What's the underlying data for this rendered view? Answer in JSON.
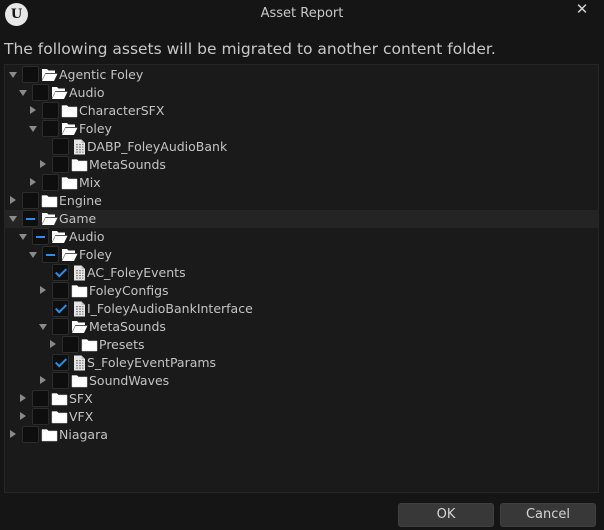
{
  "window": {
    "title": "Asset Report",
    "logo_letter": "U",
    "close_glyph": "✕"
  },
  "heading": "The following assets will be migrated to another content folder.",
  "tree": [
    {
      "label": "Agentic Foley",
      "depth": 0,
      "expander": "down",
      "check": "none",
      "icon": "folder-open-icon"
    },
    {
      "label": "Audio",
      "depth": 1,
      "expander": "down",
      "check": "none",
      "icon": "folder-open-icon"
    },
    {
      "label": "CharacterSFX",
      "depth": 2,
      "expander": "right",
      "check": "none",
      "icon": "folder-icon"
    },
    {
      "label": "Foley",
      "depth": 2,
      "expander": "down",
      "check": "none",
      "icon": "folder-open-icon"
    },
    {
      "label": "DABP_FoleyAudioBank",
      "depth": 3,
      "expander": "",
      "check": "none",
      "icon": "asset-file-icon"
    },
    {
      "label": "MetaSounds",
      "depth": 3,
      "expander": "right",
      "check": "none",
      "icon": "folder-icon"
    },
    {
      "label": "Mix",
      "depth": 2,
      "expander": "right",
      "check": "none",
      "icon": "folder-icon"
    },
    {
      "label": "Engine",
      "depth": 0,
      "expander": "right",
      "check": "none",
      "icon": "folder-icon"
    },
    {
      "label": "Game",
      "depth": 0,
      "expander": "down",
      "check": "partial",
      "icon": "folder-open-icon",
      "highlight": true
    },
    {
      "label": "Audio",
      "depth": 1,
      "expander": "down",
      "check": "partial",
      "icon": "folder-open-icon"
    },
    {
      "label": "Foley",
      "depth": 2,
      "expander": "down",
      "check": "partial",
      "icon": "folder-open-icon"
    },
    {
      "label": "AC_FoleyEvents",
      "depth": 3,
      "expander": "",
      "check": "checked",
      "icon": "asset-file-icon"
    },
    {
      "label": "FoleyConfigs",
      "depth": 3,
      "expander": "right",
      "check": "none",
      "icon": "folder-icon"
    },
    {
      "label": "I_FoleyAudioBankInterface",
      "depth": 3,
      "expander": "",
      "check": "checked",
      "icon": "asset-file-icon"
    },
    {
      "label": "MetaSounds",
      "depth": 3,
      "expander": "down",
      "check": "none",
      "icon": "folder-open-icon"
    },
    {
      "label": "Presets",
      "depth": 4,
      "expander": "right",
      "check": "none",
      "icon": "folder-icon"
    },
    {
      "label": "S_FoleyEventParams",
      "depth": 3,
      "expander": "",
      "check": "checked",
      "icon": "asset-file-icon"
    },
    {
      "label": "SoundWaves",
      "depth": 3,
      "expander": "right",
      "check": "none",
      "icon": "folder-icon"
    },
    {
      "label": "SFX",
      "depth": 1,
      "expander": "right",
      "check": "none",
      "icon": "folder-icon"
    },
    {
      "label": "VFX",
      "depth": 1,
      "expander": "right",
      "check": "none",
      "icon": "folder-icon"
    },
    {
      "label": "Niagara",
      "depth": 0,
      "expander": "right",
      "check": "none",
      "icon": "folder-icon"
    }
  ],
  "buttons": {
    "ok": "OK",
    "cancel": "Cancel"
  },
  "colors": {
    "background": "#151515",
    "tree_background": "#1a1a1a",
    "accent_blue": "#2b8de8",
    "button": "#383838"
  }
}
